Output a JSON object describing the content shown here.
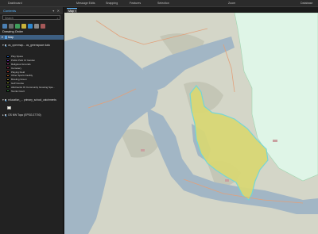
{
  "topbar": {
    "items": [
      "Dashboard",
      "Message Edits",
      "Snapping",
      "Features",
      "Selection",
      "Zoom",
      "Database"
    ]
  },
  "contents": {
    "title": "Contents",
    "controls": "▾ ✕",
    "search_placeholder": "Search",
    "drawing_order": "Drawing Order",
    "map_label": "Map",
    "layer_greenspace": "os_openmap... os_greenspace data",
    "legend_items": [
      {
        "label": "Play Space",
        "color": "#2f6fd3"
      },
      {
        "label": "Public Park Or Garden",
        "color": "#7a3cc6"
      },
      {
        "label": "Religious Grounds",
        "color": "#b23d8f"
      },
      {
        "label": "Cemetery",
        "color": "#c53f6a"
      },
      {
        "label": "Playing Field",
        "color": "#d14a3a"
      },
      {
        "label": "Other Sports Facility",
        "color": "#c76a2b"
      },
      {
        "label": "Bowling Green",
        "color": "#b58f2a"
      },
      {
        "label": "Golf Course",
        "color": "#9aa531"
      },
      {
        "label": "Allotments Or Community Growing Spa...",
        "color": "#6aa83b"
      },
      {
        "label": "Tennis Court",
        "color": "#3e9c4a"
      }
    ],
    "layer_schools": "education_... primary_school_catchments",
    "layer_basemap": "OS NW Topo (EPSG:27700)"
  },
  "map": {
    "tab_label": "Map",
    "tab_close": "✕",
    "colors": {
      "water": "#a2b6c5",
      "land": "#d4d6c8",
      "greenspace": "#dff5e7",
      "catchment": "#d9d873",
      "catchment_edge": "#6fd7d8"
    }
  }
}
